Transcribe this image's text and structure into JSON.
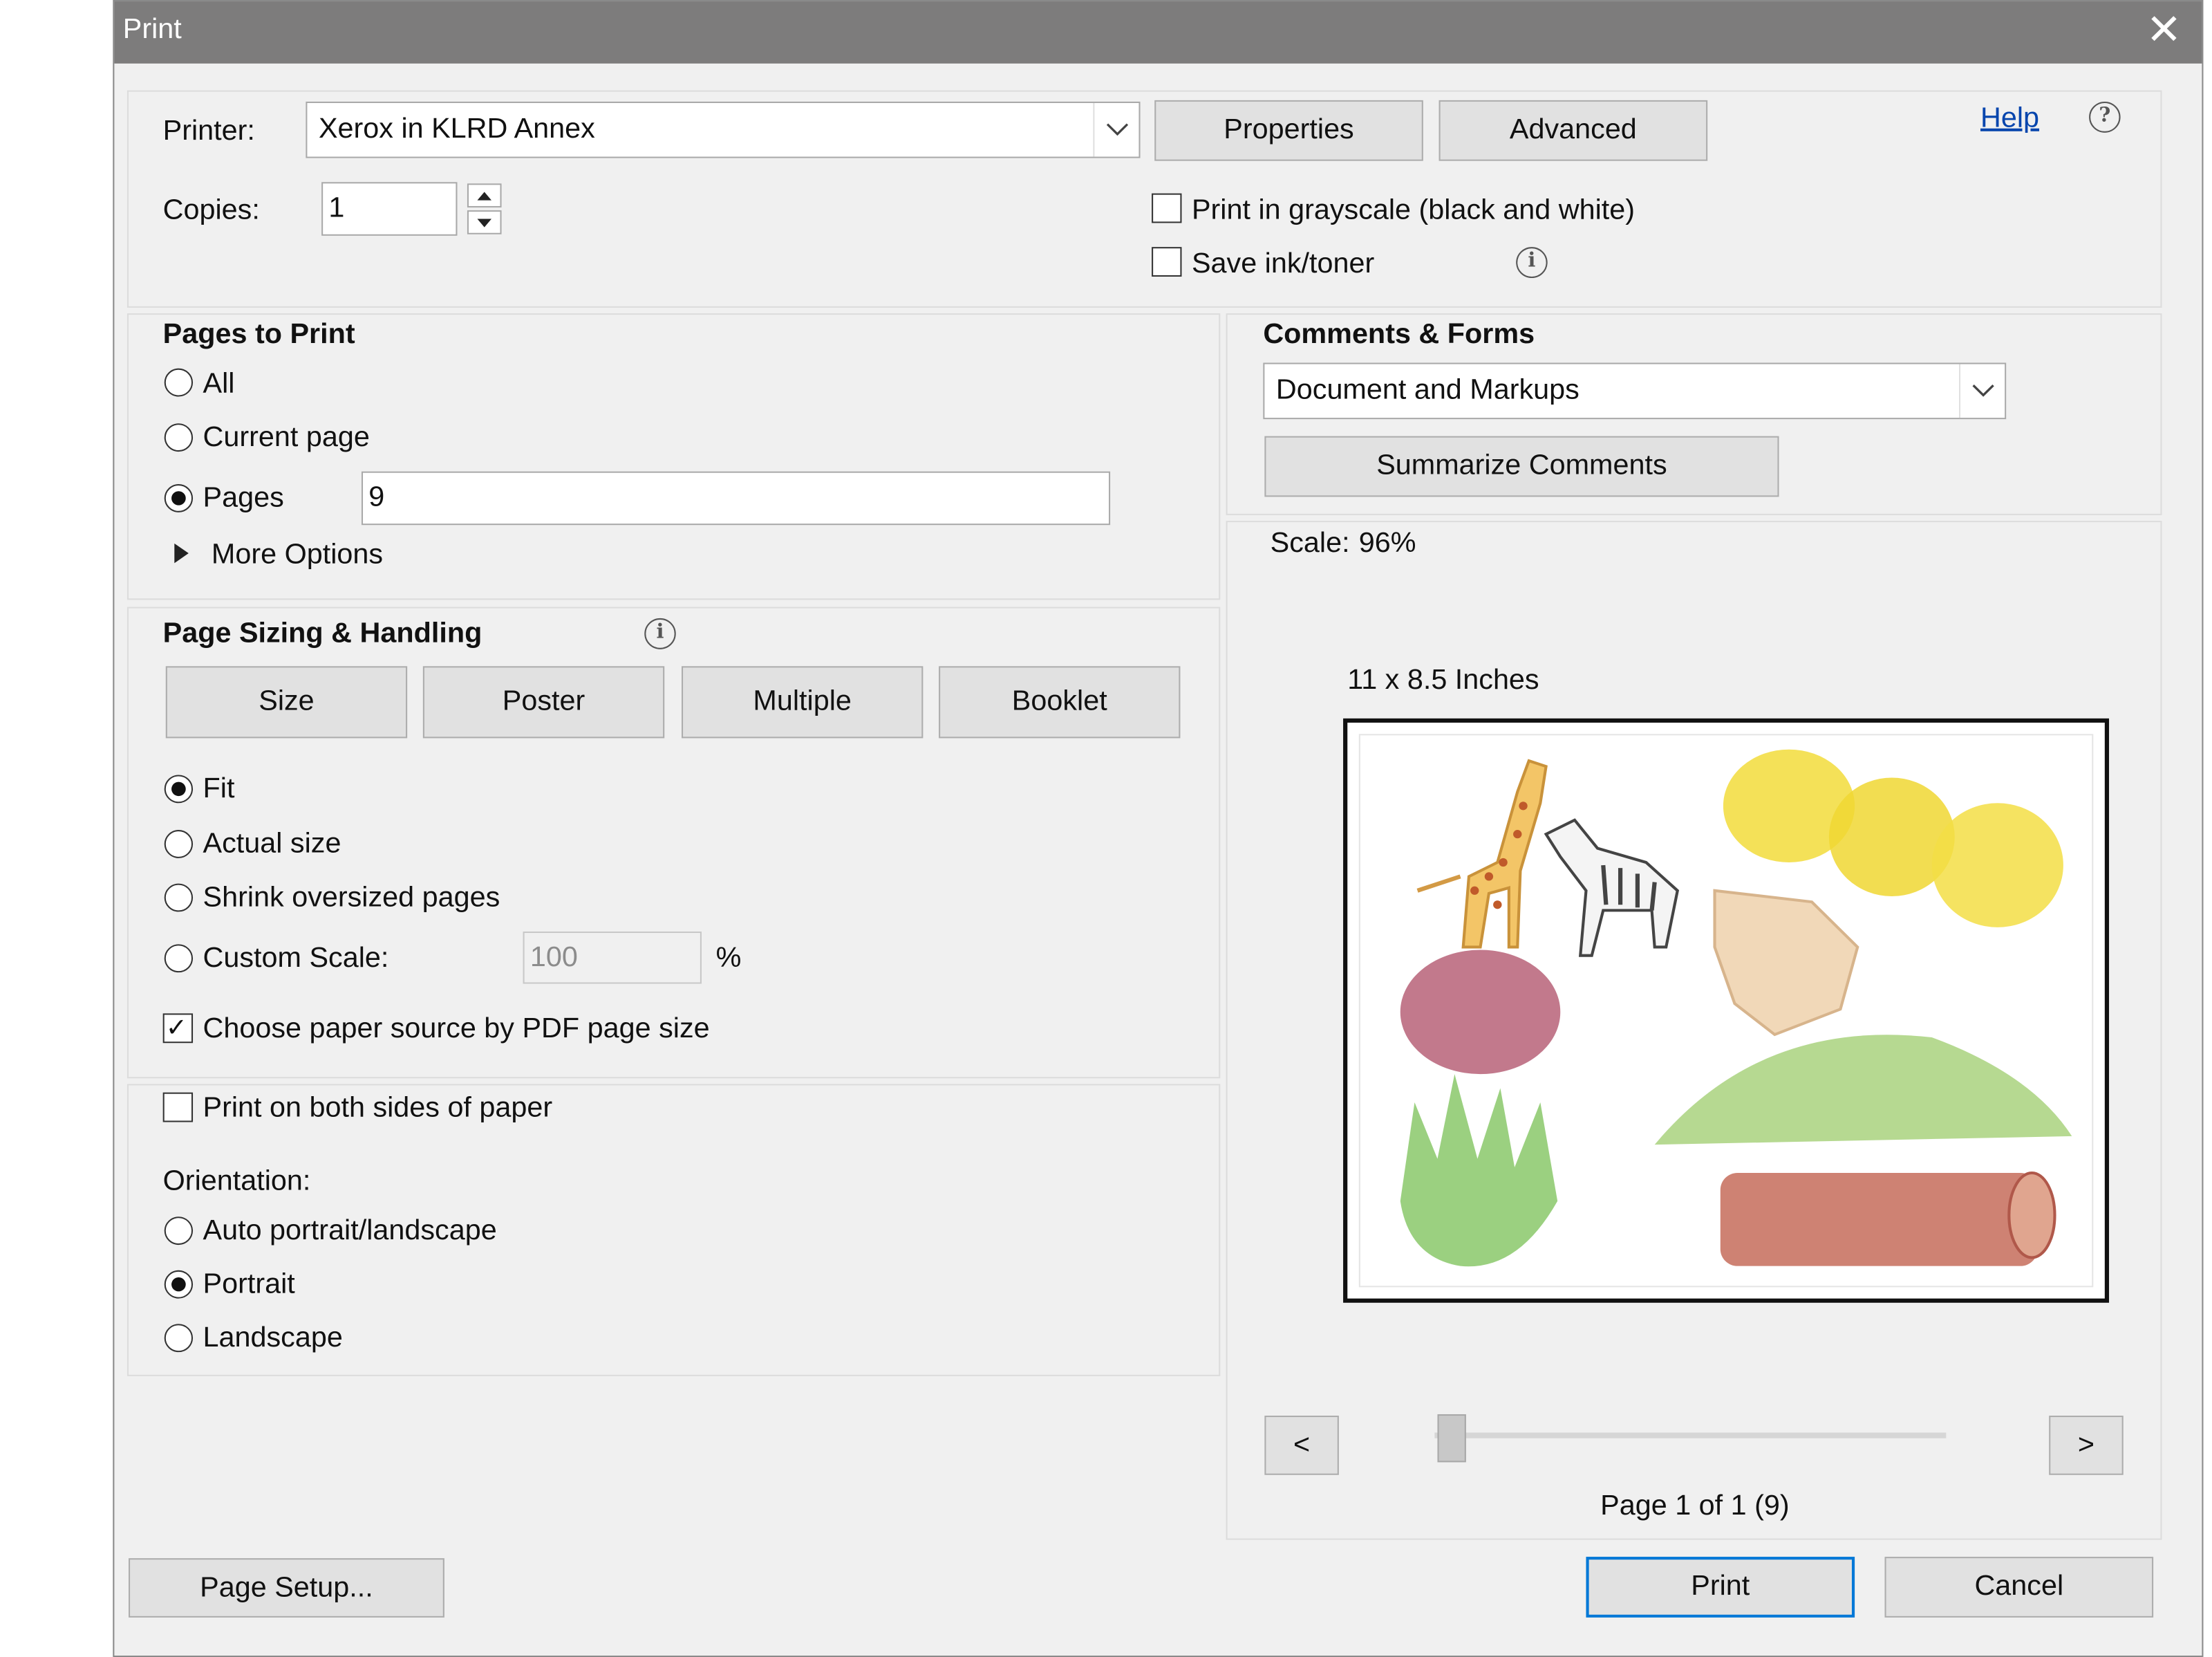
{
  "dialog": {
    "title": "Print",
    "close_glyph": "✕"
  },
  "top": {
    "printer_label": "Printer:",
    "printer_value": "Xerox in KLRD Annex",
    "properties_button": "Properties",
    "advanced_button": "Advanced",
    "help_link": "Help",
    "copies_label": "Copies:",
    "copies_value": "1",
    "grayscale_label": "Print in grayscale (black and white)",
    "grayscale_checked": false,
    "save_ink_label": "Save ink/toner",
    "save_ink_checked": false
  },
  "pages_to_print": {
    "heading": "Pages to Print",
    "all": "All",
    "current_page": "Current page",
    "pages": "Pages",
    "pages_value": "9",
    "selected": "Pages",
    "more_options": "More Options"
  },
  "sizing": {
    "heading": "Page Sizing & Handling",
    "tabs": [
      "Size",
      "Poster",
      "Multiple",
      "Booklet"
    ],
    "fit": "Fit",
    "actual_size": "Actual size",
    "shrink": "Shrink oversized pages",
    "custom_scale": "Custom Scale:",
    "custom_scale_value": "100",
    "percent": "%",
    "selected": "Fit",
    "paper_source": "Choose paper source by PDF page size",
    "paper_source_checked": true
  },
  "duplex": {
    "both_sides": "Print on both sides of paper",
    "both_sides_checked": false,
    "orientation_label": "Orientation:",
    "auto": "Auto portrait/landscape",
    "portrait": "Portrait",
    "landscape": "Landscape",
    "selected": "Portrait"
  },
  "comments": {
    "heading": "Comments & Forms",
    "value": "Document and Markups",
    "summarize_button": "Summarize Comments"
  },
  "preview": {
    "scale_label": "Scale:",
    "scale_value": "96%",
    "paper_size": "11 x 8.5 Inches",
    "prev": "<",
    "next": ">",
    "page_info": "Page 1 of 1 (9)",
    "slider_position": 0
  },
  "footer": {
    "page_setup": "Page Setup...",
    "print": "Print",
    "cancel": "Cancel"
  }
}
